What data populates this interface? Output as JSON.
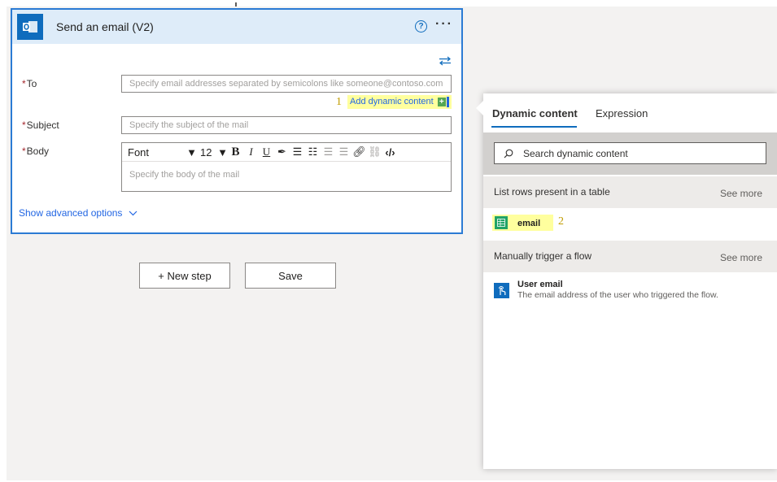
{
  "action": {
    "title": "Send an email (V2)",
    "help_glyph": "?",
    "more_glyph": "···",
    "to_label": "To",
    "to_placeholder": "Specify email addresses separated by semicolons like someone@contoso.com",
    "subject_label": "Subject",
    "subject_placeholder": "Specify the subject of the mail",
    "body_label": "Body",
    "body_placeholder": "Specify the body of the mail",
    "required_marker": "*",
    "show_advanced": "Show advanced options",
    "add_dynamic_content": "Add dynamic content",
    "annotation_1": "1",
    "editor": {
      "font": "Font",
      "font_size": "12",
      "bold": "B",
      "italic": "I",
      "underline": "U"
    }
  },
  "buttons": {
    "new_step": "+ New step",
    "save": "Save"
  },
  "panel": {
    "tabs": [
      "Dynamic content",
      "Expression"
    ],
    "active_tab": "Dynamic content",
    "search_placeholder": "Search dynamic content",
    "sections": [
      {
        "title": "List rows present in a table",
        "see_more": "See more",
        "items": [
          {
            "label": "email",
            "annotation": "2"
          }
        ]
      },
      {
        "title": "Manually trigger a flow",
        "see_more": "See more",
        "items": [
          {
            "label": "User email",
            "description": "The email address of the user who triggered the flow."
          }
        ]
      }
    ]
  },
  "colors": {
    "accent": "#0f6cbd",
    "card_border": "#2b7bd4",
    "header_bg": "#deecf9",
    "highlight": "#ffff9e",
    "annotation": "#c19c00",
    "excel_green": "#21a366"
  }
}
